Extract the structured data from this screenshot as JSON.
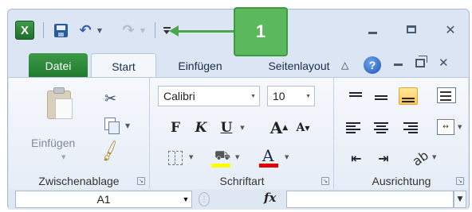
{
  "callout": {
    "number": "1",
    "color": "#5cb85c"
  },
  "qat": {
    "app_icon": "excel-logo-icon",
    "app_letter": "X",
    "save": "save-icon",
    "undo": "undo-icon",
    "redo": "redo-icon",
    "customize": "customize-qat-icon"
  },
  "tabs": [
    {
      "label": "Datei",
      "active": false
    },
    {
      "label": "Start",
      "active": true
    },
    {
      "label": "Einfügen",
      "active": false
    },
    {
      "label": "Seitenlayout",
      "active": false
    }
  ],
  "help_label": "?",
  "clipboard": {
    "group_label": "Zwischenablage",
    "paste_label": "Einfügen"
  },
  "font": {
    "group_label": "Schriftart",
    "font_name": "Calibri",
    "font_size": "10",
    "bold": "F",
    "italic": "K",
    "underline": "U",
    "grow": "A",
    "shrink": "A",
    "color_letter": "A",
    "fill_color": "#ffff00",
    "font_color": "#e00000"
  },
  "alignment": {
    "group_label": "Ausrichtung",
    "active_button": "align-bottom"
  },
  "formula_bar": {
    "name_box": "A1",
    "fx": "fx",
    "formula": ""
  }
}
